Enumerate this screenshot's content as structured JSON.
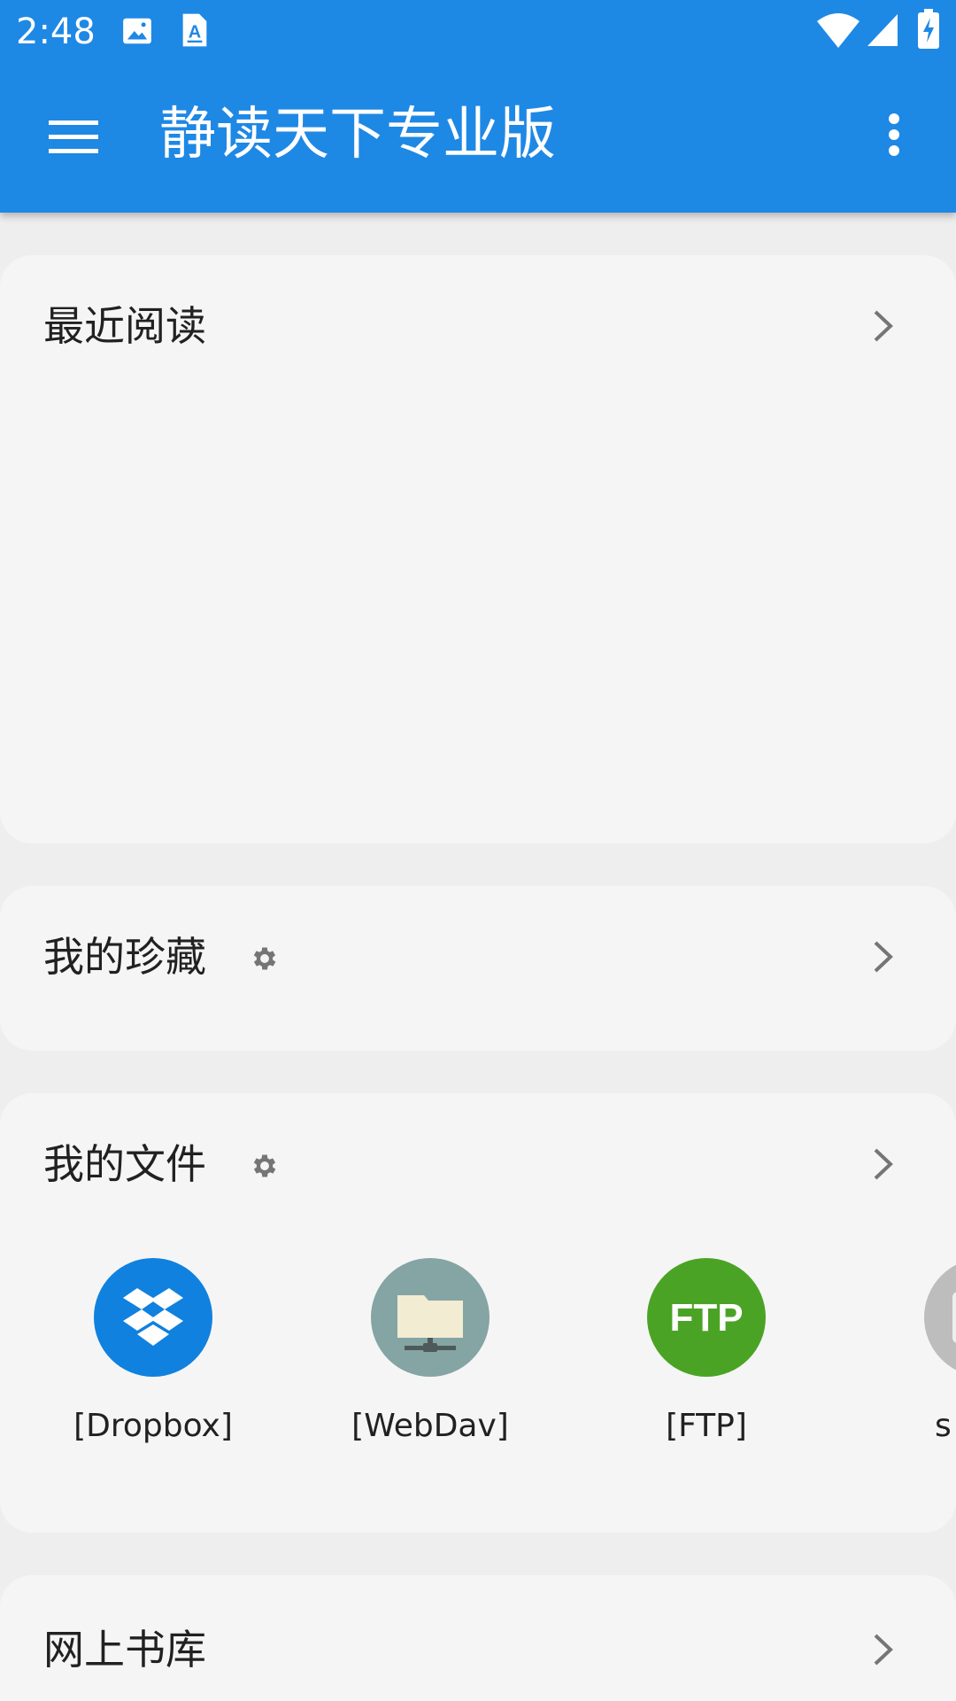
{
  "status_bar": {
    "time": "2:48",
    "icons": [
      "image-icon",
      "text-a-icon",
      "wifi-icon",
      "cellular-signal-icon",
      "battery-charging-icon"
    ]
  },
  "toolbar": {
    "title": "静读天下专业版",
    "menu_icon": "hamburger-menu-icon",
    "overflow_icon": "more-vert-icon"
  },
  "sections": {
    "recent": {
      "title": "最近阅读"
    },
    "favorite": {
      "title": "我的珍藏"
    },
    "files": {
      "title": "我的文件",
      "sources": [
        {
          "label": "[Dropbox]",
          "icon": "dropbox-icon",
          "color": "#1081de"
        },
        {
          "label": "[WebDav]",
          "icon": "webdav-icon",
          "color": "#85a4a4"
        },
        {
          "label": "[FTP]",
          "icon": "ftp-icon",
          "icon_text": "FTP",
          "color": "#4ba325"
        },
        {
          "label": "s",
          "icon": "storage-icon",
          "color": "#bdbdbd"
        }
      ]
    },
    "library": {
      "title": "网上书库"
    }
  },
  "colors": {
    "primary": "#1e88e5",
    "background": "#eeeeee",
    "card": "#f5f5f5",
    "text": "#212121",
    "icon_gray": "#757575"
  }
}
